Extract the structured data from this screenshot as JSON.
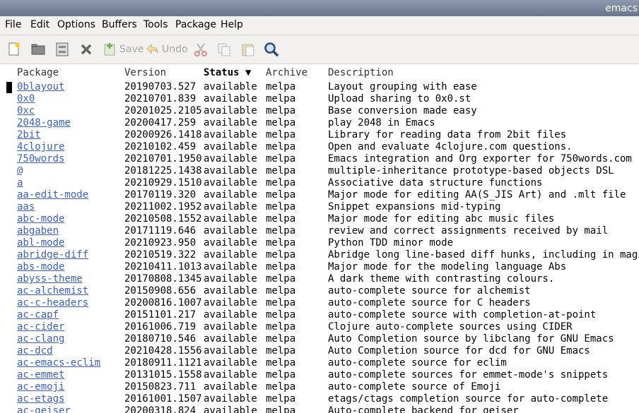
{
  "window": {
    "title": "emacs"
  },
  "menu": [
    "File",
    "Edit",
    "Options",
    "Buffers",
    "Tools",
    "Package",
    "Help"
  ],
  "toolbar": {
    "new_file_icon": "new-file-icon",
    "open_icon": "folder-open-icon",
    "dired_icon": "cabinet-icon",
    "close_icon": "close-icon",
    "save_label": "Save",
    "undo_label": "Undo",
    "cut_icon": "scissors-icon",
    "copy_icon": "copy-icon",
    "paste_icon": "paste-icon",
    "search_icon": "search-icon"
  },
  "columns": {
    "package": "Package",
    "version": "Version",
    "status": "Status ▼",
    "archive": "Archive",
    "description": "Description"
  },
  "packages": [
    {
      "name": "0blayout",
      "version": "20190703.527",
      "status": "available",
      "archive": "melpa",
      "description": "Layout grouping with ease"
    },
    {
      "name": "0x0",
      "version": "20210701.839",
      "status": "available",
      "archive": "melpa",
      "description": "Upload sharing to 0x0.st"
    },
    {
      "name": "0xc",
      "version": "20201025.2105",
      "status": "available",
      "archive": "melpa",
      "description": "Base conversion made easy"
    },
    {
      "name": "2048-game",
      "version": "20200417.259",
      "status": "available",
      "archive": "melpa",
      "description": "play 2048 in Emacs"
    },
    {
      "name": "2bit",
      "version": "20200926.1418",
      "status": "available",
      "archive": "melpa",
      "description": "Library for reading data from 2bit files"
    },
    {
      "name": "4clojure",
      "version": "20210102.459",
      "status": "available",
      "archive": "melpa",
      "description": "Open and evaluate 4clojure.com questions."
    },
    {
      "name": "750words",
      "version": "20210701.1950",
      "status": "available",
      "archive": "melpa",
      "description": "Emacs integration and Org exporter for 750words.com"
    },
    {
      "name": "@",
      "version": "20181225.1438",
      "status": "available",
      "archive": "melpa",
      "description": "multiple-inheritance prototype-based objects DSL"
    },
    {
      "name": "a",
      "version": "20210929.1510",
      "status": "available",
      "archive": "melpa",
      "description": "Associative data structure functions"
    },
    {
      "name": "aa-edit-mode",
      "version": "20170119.320",
      "status": "available",
      "archive": "melpa",
      "description": "Major mode for editing AA(S_JIS Art) and .mlt file"
    },
    {
      "name": "aas",
      "version": "20211002.1952",
      "status": "available",
      "archive": "melpa",
      "description": "Snippet expansions mid-typing"
    },
    {
      "name": "abc-mode",
      "version": "20210508.1552",
      "status": "available",
      "archive": "melpa",
      "description": "Major mode for editing abc music files"
    },
    {
      "name": "abgaben",
      "version": "20171119.646",
      "status": "available",
      "archive": "melpa",
      "description": "review and correct assignments received by mail"
    },
    {
      "name": "abl-mode",
      "version": "20210923.950",
      "status": "available",
      "archive": "melpa",
      "description": "Python TDD minor mode"
    },
    {
      "name": "abridge-diff",
      "version": "20210519.322",
      "status": "available",
      "archive": "melpa",
      "description": "Abridge long line-based diff hunks, including in magit"
    },
    {
      "name": "abs-mode",
      "version": "20210411.1013",
      "status": "available",
      "archive": "melpa",
      "description": "Major mode for the modeling language Abs"
    },
    {
      "name": "abyss-theme",
      "version": "20170808.1345",
      "status": "available",
      "archive": "melpa",
      "description": "A dark theme with contrasting colours."
    },
    {
      "name": "ac-alchemist",
      "version": "20150908.656",
      "status": "available",
      "archive": "melpa",
      "description": "auto-complete source for alchemist"
    },
    {
      "name": "ac-c-headers",
      "version": "20200816.1007",
      "status": "available",
      "archive": "melpa",
      "description": "auto-complete source for C headers"
    },
    {
      "name": "ac-capf",
      "version": "20151101.217",
      "status": "available",
      "archive": "melpa",
      "description": "auto-complete source with completion-at-point"
    },
    {
      "name": "ac-cider",
      "version": "20161006.719",
      "status": "available",
      "archive": "melpa",
      "description": "Clojure auto-complete sources using CIDER"
    },
    {
      "name": "ac-clang",
      "version": "20180710.546",
      "status": "available",
      "archive": "melpa",
      "description": "Auto Completion source by libclang for GNU Emacs"
    },
    {
      "name": "ac-dcd",
      "version": "20210428.1556",
      "status": "available",
      "archive": "melpa",
      "description": "Auto Completion source for dcd for GNU Emacs"
    },
    {
      "name": "ac-emacs-eclim",
      "version": "20180911.1121",
      "status": "available",
      "archive": "melpa",
      "description": "auto-complete source for eclim"
    },
    {
      "name": "ac-emmet",
      "version": "20131015.1558",
      "status": "available",
      "archive": "melpa",
      "description": "auto-complete sources for emmet-mode's snippets"
    },
    {
      "name": "ac-emoji",
      "version": "20150823.711",
      "status": "available",
      "archive": "melpa",
      "description": "auto-complete source of Emoji"
    },
    {
      "name": "ac-etags",
      "version": "20161001.1507",
      "status": "available",
      "archive": "melpa",
      "description": "etags/ctags completion source for auto-complete"
    },
    {
      "name": "ac-geiser",
      "version": "20200318.824",
      "status": "available",
      "archive": "melpa",
      "description": "Auto-complete backend for geiser"
    }
  ]
}
